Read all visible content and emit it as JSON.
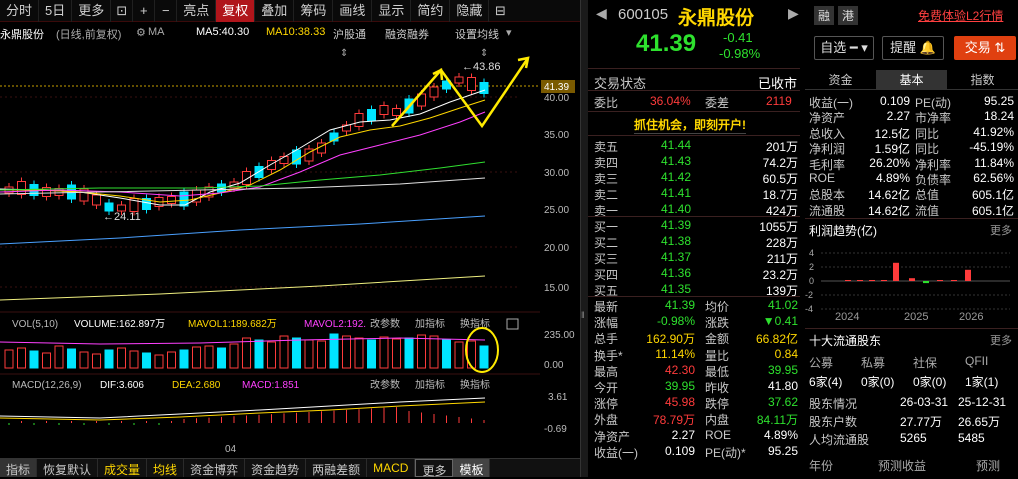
{
  "toolbar": {
    "tabs": [
      "分时",
      "5日",
      "更多",
      "+",
      "−",
      "亮点",
      "复权",
      "叠加",
      "筹码",
      "画线",
      "显示",
      "简约",
      "隐藏"
    ]
  },
  "chart_info": {
    "name": "永鼎股份",
    "mode": "(日线,前复权)",
    "ma_label": "MA",
    "ma5": "MA5:40.30",
    "ma10": "MA10:38.33",
    "hgt": "沪股通",
    "rzrq": "融资融券",
    "set_ma": "设置均线"
  },
  "price_axis": {
    "labels": [
      "40.00",
      "35.00",
      "30.00",
      "25.00",
      "20.00",
      "15.00"
    ],
    "last": "41.39"
  },
  "annot": {
    "high": "43.86",
    "low": "24.11"
  },
  "vol": {
    "label": "VOL(5,10)",
    "volume": "VOLUME:162.897万",
    "mavol1": "MAVOL1:189.682万",
    "mavol2": "MAVOL2:192.",
    "params": "改参数",
    "add": "加指标",
    "switch": "换指标",
    "axis": [
      "235.00",
      "0.00"
    ]
  },
  "macd": {
    "label": "MACD(12,26,9)",
    "dif": "DIF:3.606",
    "dea": "DEA:2.680",
    "macd": "MACD:1.851",
    "params": "改参数",
    "add": "加指标",
    "switch": "换指标",
    "axis": [
      "3.61",
      "-0.69"
    ],
    "month": "04"
  },
  "bottom_tabs": [
    "指标",
    "恢复默认",
    "成交量",
    "均线",
    "资金博弈",
    "资金趋势",
    "两融差额",
    "MACD",
    "更多",
    "模板"
  ],
  "stock": {
    "code": "600105",
    "name": "永鼎股份",
    "rong": "融",
    "gang": "港",
    "l2": "免费体验L2行情",
    "price": "41.39",
    "chg": "-0.41",
    "pct": "-0.98%"
  },
  "buttons": {
    "zixuan": "自选",
    "tixing": "提醒",
    "jiaoyi": "交易"
  },
  "status": {
    "label": "交易状态",
    "value": "已收市",
    "weibi_k": "委比",
    "weibi": "36.04%",
    "weicha_k": "委差",
    "weicha": "2119"
  },
  "promo": "抓住机会，即刻开户!",
  "asks": [
    {
      "k": "卖五",
      "p": "41.44",
      "v": "201万"
    },
    {
      "k": "卖四",
      "p": "41.43",
      "v": "74.2万"
    },
    {
      "k": "卖三",
      "p": "41.42",
      "v": "60.5万"
    },
    {
      "k": "卖二",
      "p": "41.41",
      "v": "18.7万"
    },
    {
      "k": "卖一",
      "p": "41.40",
      "v": "424万"
    }
  ],
  "bids": [
    {
      "k": "买一",
      "p": "41.39",
      "v": "1055万"
    },
    {
      "k": "买二",
      "p": "41.38",
      "v": "228万"
    },
    {
      "k": "买三",
      "p": "41.37",
      "v": "211万"
    },
    {
      "k": "买四",
      "p": "41.36",
      "v": "23.2万"
    },
    {
      "k": "买五",
      "p": "41.35",
      "v": "139万"
    }
  ],
  "stats": [
    {
      "k": "最新",
      "v": "41.39",
      "c": "green",
      "k2": "均价",
      "v2": "41.02",
      "c2": "green"
    },
    {
      "k": "涨幅",
      "v": "-0.98%",
      "c": "green",
      "k2": "涨跌",
      "v2": "▼0.41",
      "c2": "green"
    },
    {
      "k": "总手",
      "v": "162.90万",
      "c": "yellow",
      "k2": "金额",
      "v2": "66.82亿",
      "c2": "yellow"
    },
    {
      "k": "换手*",
      "v": "11.14%",
      "c": "yellow",
      "k2": "量比",
      "v2": "0.84",
      "c2": "yellow"
    },
    {
      "k": "最高",
      "v": "42.30",
      "c": "red",
      "k2": "最低",
      "v2": "39.95",
      "c2": "green"
    },
    {
      "k": "今开",
      "v": "39.95",
      "c": "green",
      "k2": "昨收",
      "v2": "41.80",
      "c2": "white"
    },
    {
      "k": "涨停",
      "v": "45.98",
      "c": "red",
      "k2": "跌停",
      "v2": "37.62",
      "c2": "green"
    },
    {
      "k": "外盘",
      "v": "78.79万",
      "c": "red",
      "k2": "内盘",
      "v2": "84.11万",
      "c2": "green"
    },
    {
      "k": "净资产",
      "v": "2.27",
      "c": "white",
      "k2": "ROE",
      "v2": "4.89%",
      "c2": "white"
    },
    {
      "k": "收益(一)",
      "v": "0.109",
      "c": "white",
      "k2": "PE(动)*",
      "v2": "95.25",
      "c2": "white"
    }
  ],
  "rtabs": [
    "资金",
    "基本",
    "指数"
  ],
  "fundamentals": [
    {
      "k": "收益(一)",
      "v": "0.109",
      "k2": "PE(动)",
      "v2": "95.25"
    },
    {
      "k": "净资产",
      "v": "2.27",
      "k2": "市净率",
      "v2": "18.24"
    },
    {
      "k": "总收入",
      "v": "12.5亿",
      "k2": "同比",
      "v2": "41.92%"
    },
    {
      "k": "净利润",
      "v": "1.59亿",
      "k2": "同比",
      "v2": "-45.19%"
    },
    {
      "k": "毛利率",
      "v": "26.20%",
      "k2": "净利率",
      "v2": "11.84%"
    },
    {
      "k": "ROE",
      "v": "4.89%",
      "k2": "负债率",
      "v2": "62.56%"
    },
    {
      "k": "总股本",
      "v": "14.62亿",
      "k2": "总值",
      "v2": "605.1亿"
    },
    {
      "k": "流通股",
      "v": "14.62亿",
      "k2": "流值",
      "v2": "605.1亿"
    }
  ],
  "profit": {
    "title": "利润趋势(亿)",
    "more": "更多",
    "y": [
      "4",
      "2",
      "0",
      "-2",
      "-4"
    ],
    "x": [
      "2024",
      "2025",
      "2026"
    ]
  },
  "chart_data": {
    "type": "bar",
    "title": "利润趋势(亿)",
    "x": [
      "2024",
      "2025",
      "2026"
    ],
    "ylim": [
      -4,
      4
    ],
    "values": [
      0.1,
      0.1,
      0.1,
      0.1,
      2.6,
      0.4,
      -0.3,
      0.1,
      0.1,
      1.6
    ]
  },
  "holders": {
    "title": "十大流通股东",
    "more": "更多",
    "cols": [
      "公募",
      "私募",
      "社保",
      "QFII"
    ],
    "vals": [
      "6家(4)",
      "0家(0)",
      "0家(0)",
      "1家(1)"
    ],
    "rows": [
      {
        "k": "股东情况",
        "a": "26-03-31",
        "b": "25-12-31"
      },
      {
        "k": "股东户数",
        "a": "27.77万",
        "b": "26.65万"
      },
      {
        "k": "人均流通股",
        "a": "5265",
        "b": "5485"
      }
    ],
    "footer": [
      "年份",
      "预测收益",
      "预测"
    ]
  }
}
